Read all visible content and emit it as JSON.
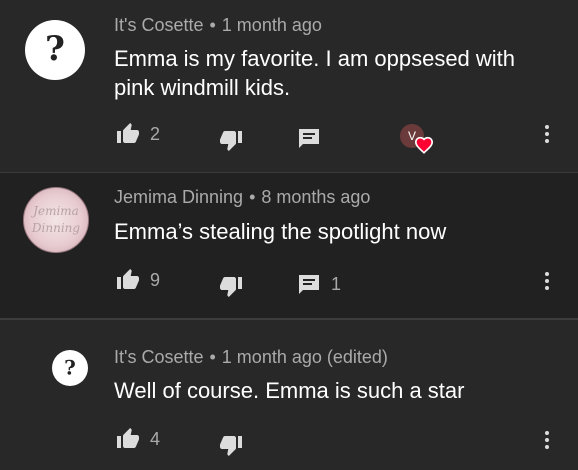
{
  "comments": [
    {
      "author": "It's Cosette",
      "separator": "•",
      "time": "1 month ago",
      "text": "Emma is my favorite. I am oppsesed with pink windmill kids.",
      "likes": "2",
      "reply_count": "",
      "creator_heart_avatar_letter": "V"
    },
    {
      "author": "Jemima Dinning",
      "separator": "•",
      "time": "8 months ago",
      "text": "Emma’s stealing the spotlight now",
      "likes": "9",
      "reply_count": "1"
    },
    {
      "author": "It's Cosette",
      "separator": "•",
      "time": "1 month ago (edited)",
      "text": "Well of course. Emma is such a star",
      "likes": "4"
    }
  ],
  "avatar_glyph": "?",
  "jemima_avatar_lines": [
    "Jemima",
    "Dinning"
  ],
  "icons": {
    "like": "thumb-up-icon",
    "dislike": "thumb-down-icon",
    "reply": "comment-icon",
    "more": "more-vert-icon",
    "heart": "heart-icon"
  },
  "colors": {
    "background": "#282828",
    "background_alt": "#212121",
    "primary_text": "#ffffff",
    "secondary_text": "#aaaaaa",
    "icon": "#dcdcdc",
    "heart": "#ff0033"
  }
}
